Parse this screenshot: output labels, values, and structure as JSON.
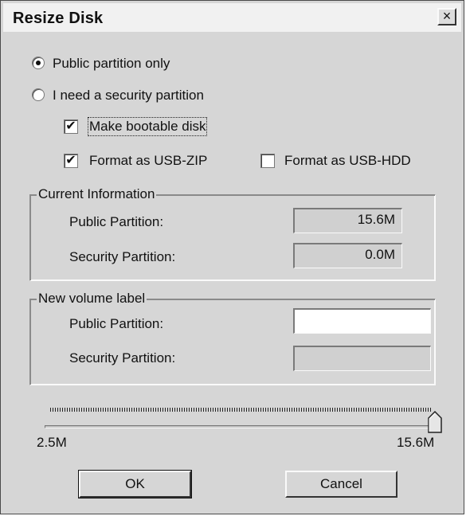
{
  "window": {
    "title": "Resize Disk",
    "close_glyph": "×"
  },
  "options": {
    "public_only_label": "Public partition only",
    "public_only_selected": true,
    "security_label": "I need a security partition",
    "security_selected": false,
    "bootable_label": "Make bootable disk",
    "bootable_checked": true,
    "usb_zip_label": "Format as USB-ZIP",
    "usb_zip_checked": true,
    "usb_hdd_label": "Format as USB-HDD",
    "usb_hdd_checked": false,
    "check_glyph": "✔"
  },
  "current_info": {
    "title": "Current Information",
    "public_label": "Public Partition:",
    "public_value": "15.6M",
    "security_label": "Security Partition:",
    "security_value": "0.0M"
  },
  "new_label": {
    "title": "New volume label",
    "public_label": "Public Partition:",
    "public_value": "",
    "security_label": "Security Partition:",
    "security_value": ""
  },
  "slider": {
    "min_label": "2.5M",
    "max_label": "15.6M",
    "min": 2.5,
    "max": 15.6,
    "value": 15.6
  },
  "buttons": {
    "ok_label": "OK",
    "cancel_label": "Cancel"
  }
}
